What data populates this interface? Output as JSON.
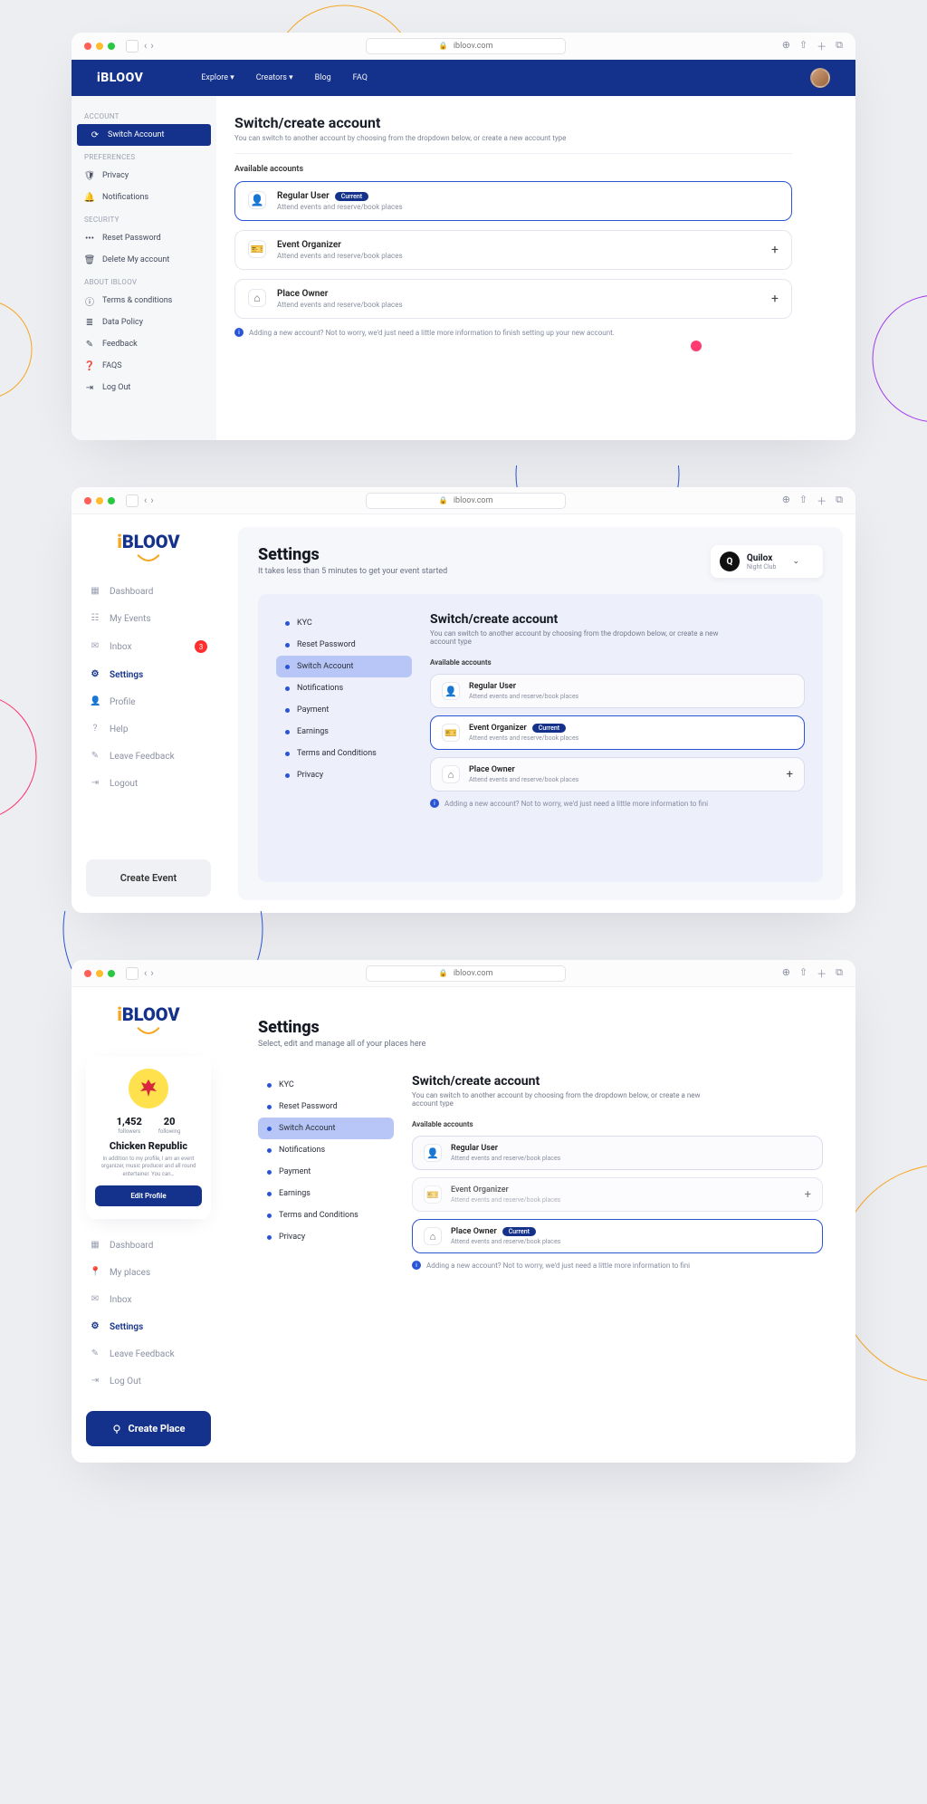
{
  "url": "ibloov.com",
  "window1": {
    "brand": "iBLOOV",
    "nav": [
      "Explore",
      "Creators",
      "Blog",
      "FAQ"
    ],
    "sidebar": {
      "groups": [
        {
          "title": "ACCOUNT",
          "items": [
            {
              "icon": "⟳",
              "label": "Switch Account",
              "active": true
            }
          ]
        },
        {
          "title": "PREFERENCES",
          "items": [
            {
              "icon": "🛡",
              "label": "Privacy"
            },
            {
              "icon": "🔔",
              "label": "Notifications"
            }
          ]
        },
        {
          "title": "SECURITY",
          "items": [
            {
              "icon": "•••",
              "label": "Reset Password"
            },
            {
              "icon": "🗑",
              "label": "Delete My account"
            }
          ]
        },
        {
          "title": "ABOUT IBLOOV",
          "items": [
            {
              "icon": "ⓘ",
              "label": "Terms & conditions"
            },
            {
              "icon": "≣",
              "label": "Data Policy"
            },
            {
              "icon": "✎",
              "label": "Feedback"
            },
            {
              "icon": "❓",
              "label": "FAQS"
            },
            {
              "icon": "⇥",
              "label": "Log Out"
            }
          ]
        }
      ]
    },
    "title": "Switch/create account",
    "subtitle": "You can switch to another account by choosing from the dropdown below, or create a new account type",
    "available_label": "Available accounts",
    "accounts": [
      {
        "icon": "👤",
        "name": "Regular User",
        "desc": "Attend events and reserve/book places",
        "current": true,
        "add": false
      },
      {
        "icon": "🎫",
        "name": "Event Organizer",
        "desc": "Attend events and reserve/book places",
        "current": false,
        "add": true
      },
      {
        "icon": "⌂",
        "name": "Place Owner",
        "desc": "Attend events and reserve/book places",
        "current": false,
        "add": true
      }
    ],
    "current_label": "Current",
    "info": "Adding a new account? Not to worry, we'd just need a little more information to finish setting up your new account."
  },
  "window2": {
    "brand_i": "i",
    "brand_b": "BLOOV",
    "sidebar_items": [
      {
        "icon": "▦",
        "label": "Dashboard"
      },
      {
        "icon": "☷",
        "label": "My Events"
      },
      {
        "icon": "✉",
        "label": "Inbox",
        "badge": "3"
      },
      {
        "icon": "⚙",
        "label": "Settings",
        "active": true
      },
      {
        "icon": "👤",
        "label": "Profile"
      },
      {
        "icon": "?",
        "label": "Help"
      },
      {
        "icon": "✎",
        "label": "Leave Feedback"
      },
      {
        "icon": "⇥",
        "label": "Logout"
      }
    ],
    "cta": "Create Event",
    "title": "Settings",
    "subtitle": "It takes less than 5 minutes to get your event started",
    "switcher": {
      "initial": "Q",
      "name": "Quilox",
      "detail": "Night Club"
    },
    "subnav": [
      "KYC",
      "Reset Password",
      "Switch Account",
      "Notifications",
      "Payment",
      "Earnings",
      "Terms and Conditions",
      "Privacy"
    ],
    "subnav_active": 2,
    "panel": {
      "title": "Switch/create account",
      "subtitle": "You can switch to another account by choosing from the dropdown below, or create a new account type",
      "available_label": "Available accounts",
      "accounts": [
        {
          "icon": "👤",
          "name": "Regular User",
          "desc": "Attend events and reserve/book places",
          "current": false,
          "add": false
        },
        {
          "icon": "🎫",
          "name": "Event Organizer",
          "desc": "Attend events and reserve/book places",
          "current": true,
          "add": false
        },
        {
          "icon": "⌂",
          "name": "Place Owner",
          "desc": "Attend events and reserve/book places",
          "current": false,
          "add": true
        }
      ],
      "current_label": "Current",
      "info": "Adding a new account? Not to worry, we'd just need a little more information to fini"
    }
  },
  "window3": {
    "brand_i": "i",
    "brand_b": "BLOOV",
    "profile": {
      "followers": "1,452",
      "followers_label": "followers",
      "following": "20",
      "following_label": "following",
      "name": "Chicken Republic",
      "bio": "In addition to my profile, I am an event organizer, music producer and all round entertainer. You can…",
      "edit": "Edit Profile"
    },
    "sidebar_items": [
      {
        "icon": "▦",
        "label": "Dashboard"
      },
      {
        "icon": "📍",
        "label": "My places"
      },
      {
        "icon": "✉",
        "label": "Inbox"
      },
      {
        "icon": "⚙",
        "label": "Settings",
        "active": true
      },
      {
        "icon": "✎",
        "label": "Leave Feedback"
      },
      {
        "icon": "⇥",
        "label": "Log Out"
      }
    ],
    "cta": "Create Place",
    "title": "Settings",
    "subtitle": "Select, edit and manage all of your places here",
    "subnav": [
      "KYC",
      "Reset Password",
      "Switch Account",
      "Notifications",
      "Payment",
      "Earnings",
      "Terms and Conditions",
      "Privacy"
    ],
    "subnav_active": 2,
    "panel": {
      "title": "Switch/create account",
      "subtitle": "You can switch to another account by choosing from the dropdown below, or create a new account type",
      "available_label": "Available accounts",
      "accounts": [
        {
          "icon": "👤",
          "name": "Regular User",
          "desc": "Attend events and reserve/book places",
          "current": false,
          "add": false,
          "dis": false
        },
        {
          "icon": "🎫",
          "name": "Event Organizer",
          "desc": "Attend events and reserve/book places",
          "current": false,
          "add": true,
          "dis": true
        },
        {
          "icon": "⌂",
          "name": "Place Owner",
          "desc": "Attend events and reserve/book places",
          "current": true,
          "add": false,
          "dis": false
        }
      ],
      "current_label": "Current",
      "info": "Adding a new account? Not to worry, we'd just need a little more information to fini"
    }
  }
}
